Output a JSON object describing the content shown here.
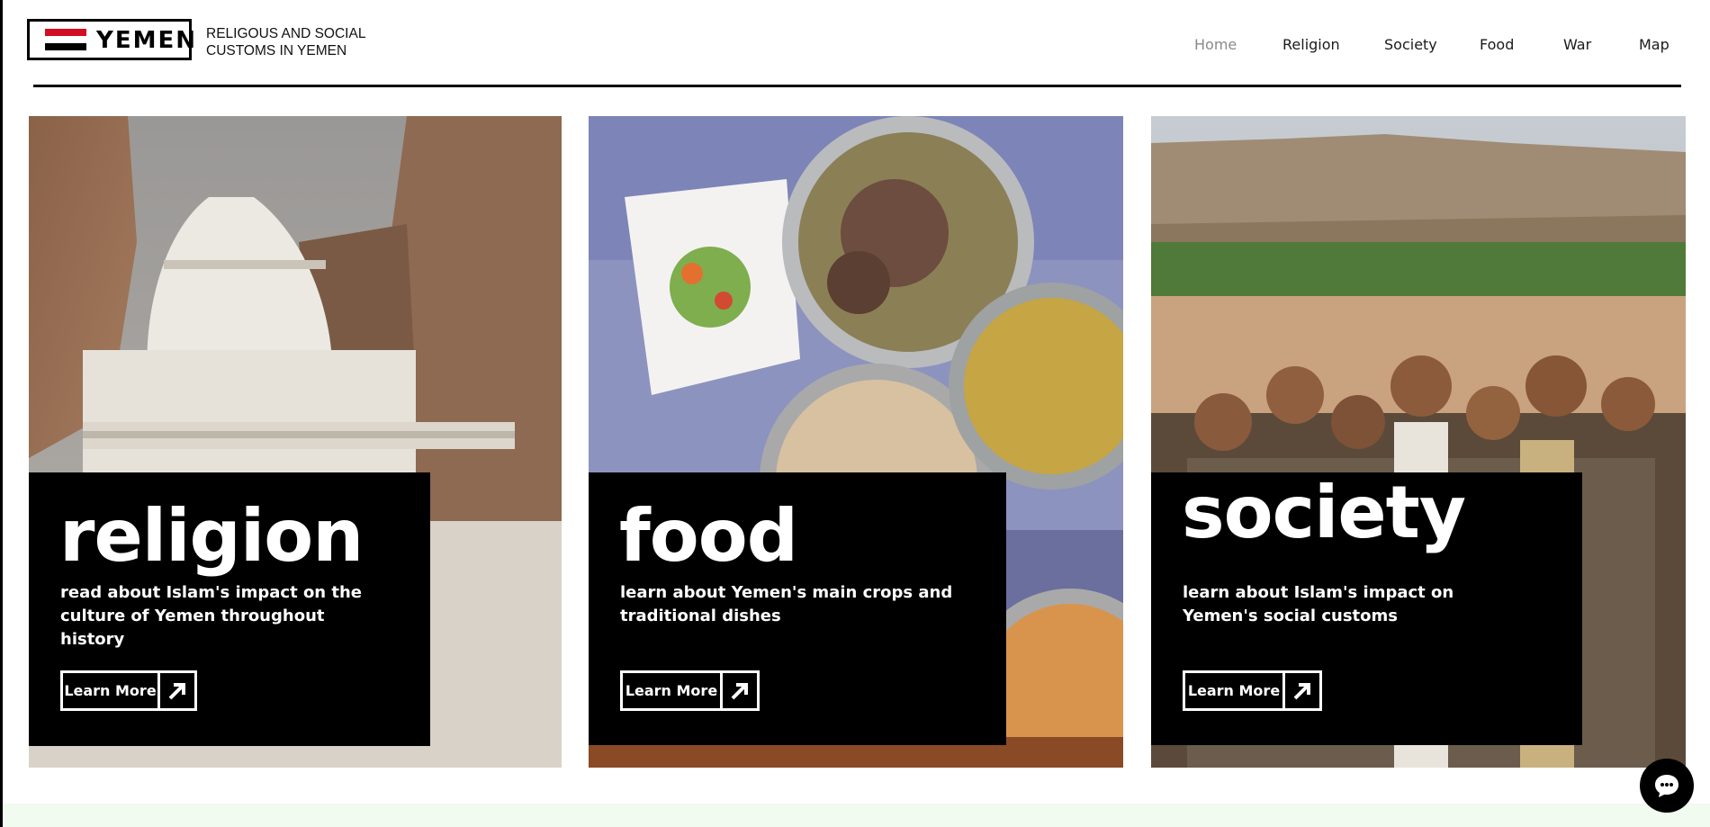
{
  "brand": {
    "flag_colors": [
      "#d20e20",
      "#ffffff",
      "#000000"
    ],
    "name": "YEMEN",
    "tagline": "RELIGOUS AND SOCIAL\nCUSTOMS IN YEMEN"
  },
  "nav": {
    "items": [
      {
        "label": "Home",
        "active": true
      },
      {
        "label": "Religion",
        "active": false
      },
      {
        "label": "Society",
        "active": false
      },
      {
        "label": "Food",
        "active": false
      },
      {
        "label": "War",
        "active": false
      },
      {
        "label": "Map",
        "active": false
      }
    ]
  },
  "cards": [
    {
      "title": "religion",
      "description": "read about Islam's impact on the culture of Yemen throughout history",
      "button_label": "Learn More",
      "image": "white domed shrine in rocky canyon"
    },
    {
      "title": "food",
      "description": "learn about Yemen's main crops and traditional dishes",
      "button_label": "Learn More",
      "image": "traditional Yemeni dishes on a patterned tablecloth"
    },
    {
      "title": "society",
      "description": "learn about Islam's impact on Yemen's social customs",
      "button_label": "Learn More",
      "image": "group of young men in traditional dress before mountains"
    }
  ],
  "icons": {
    "arrow": "arrow-up-right-icon",
    "chat": "chat-bubble-icon"
  },
  "colors": {
    "overlay": "#000000",
    "footer_band": "#f1fbef",
    "nav_active": "#8a8a8a"
  }
}
